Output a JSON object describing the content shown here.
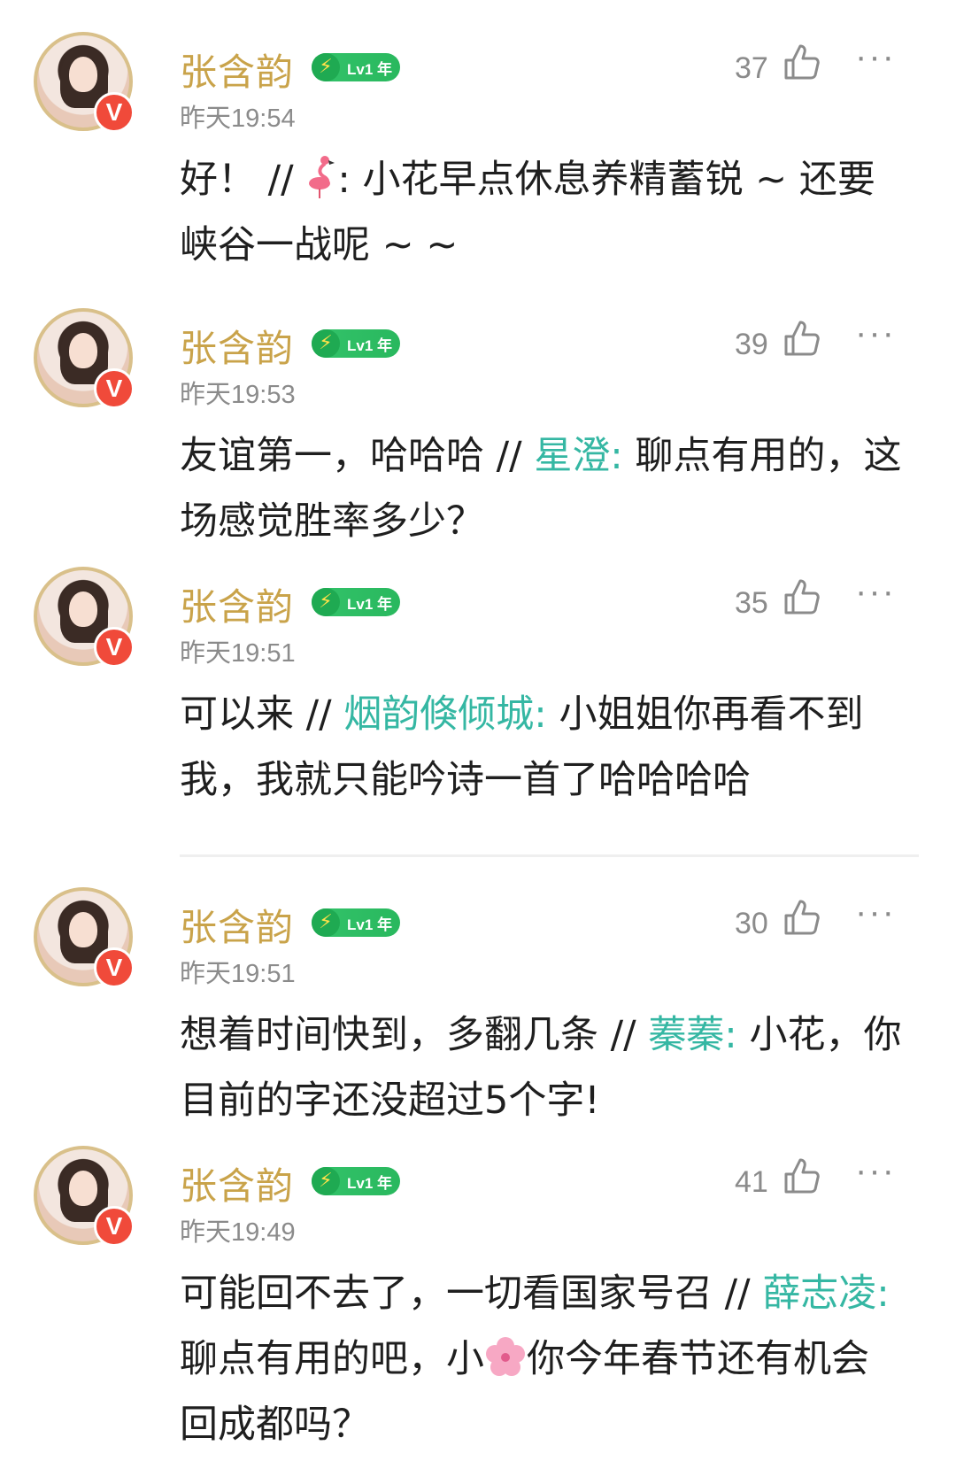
{
  "comments": [
    {
      "name": "张含韵",
      "level_badge": "Lv1 年",
      "time": "昨天19:54",
      "likes": "37",
      "text_before": "好！ // ",
      "mention": "",
      "text_after": ": 小花早点休息养精蓄锐 ~ 还要峡谷一战呢 ~ ~"
    },
    {
      "name": "张含韵",
      "level_badge": "Lv1 年",
      "time": "昨天19:53",
      "likes": "39",
      "text_before": "友谊第一，哈哈哈 // ",
      "mention": "星澄:",
      "text_after": " 聊点有用的，这场感觉胜率多少？"
    },
    {
      "name": "张含韵",
      "level_badge": "Lv1 年",
      "time": "昨天19:51",
      "likes": "35",
      "text_before": "可以来 // ",
      "mention": "烟韵倏倾城:",
      "text_after": " 小姐姐你再看不到我，我就只能吟诗一首了哈哈哈哈"
    },
    {
      "name": "张含韵",
      "level_badge": "Lv1 年",
      "time": "昨天19:51",
      "likes": "30",
      "text_before": "想着时间快到，多翻几条 // ",
      "mention": "蓁蓁:",
      "text_after": " 小花，你目前的字还没超过5个字!"
    },
    {
      "name": "张含韵",
      "level_badge": "Lv1 年",
      "time": "昨天19:49",
      "likes": "41",
      "text_before": "可能回不去了，一切看国家号召 // ",
      "mention": "薛志凌:",
      "text_mid": " 聊点有用的吧，小",
      "text_after": "你今年春节还有机会回成都吗？"
    }
  ],
  "icons": {
    "like": "thumbs-up-icon",
    "more": "more-dots-icon",
    "verified": "verified-v-icon",
    "level": "lightning-icon",
    "flamingo": "flamingo-emoji",
    "flower": "cherry-blossom-emoji"
  },
  "colors": {
    "name": "#c9a34a",
    "mention": "#35b7a3",
    "badge_green": "#33c36a",
    "verified_red": "#f04a3a"
  },
  "ui": {
    "verified_label": "V",
    "more_label": "···",
    "bolt": "⚡"
  }
}
